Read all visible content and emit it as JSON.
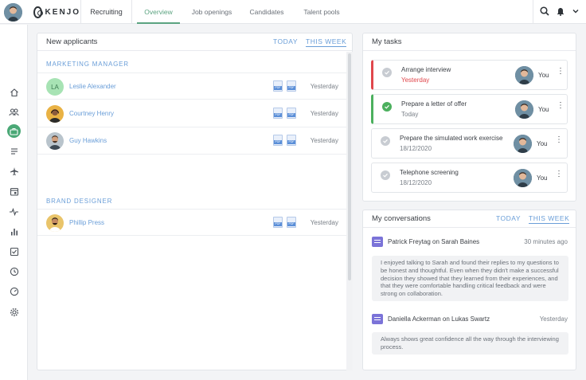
{
  "header": {
    "brand": "KENJO",
    "section": "Recruiting",
    "tabs": [
      {
        "label": "Overview",
        "active": true
      },
      {
        "label": "Job openings",
        "active": false
      },
      {
        "label": "Candidates",
        "active": false
      },
      {
        "label": "Talent pools",
        "active": false
      }
    ]
  },
  "sidebar": {
    "items": [
      "home-icon",
      "people-icon",
      "briefcase-icon",
      "list-icon",
      "plane-icon",
      "calendar-icon",
      "pulse-icon",
      "bar-chart-icon",
      "checkbox-icon",
      "clock-icon",
      "gauge-icon",
      "gear-icon"
    ],
    "active": "briefcase-icon"
  },
  "applicants": {
    "title": "New applicants",
    "period_today": "TODAY",
    "period_week": "THIS WEEK",
    "groups": [
      {
        "label": "MARKETING MANAGER",
        "rows": [
          {
            "name": "Leslie Alexander",
            "initials": "LA",
            "time": "Yesterday",
            "pdf1": "PDF",
            "pdf2": "PDF"
          },
          {
            "name": "Courtney Henry",
            "time": "Yesterday",
            "pdf1": "PDF",
            "pdf2": "PDF"
          },
          {
            "name": "Guy Hawkins",
            "time": "Yesterday",
            "pdf1": "PDF",
            "pdf2": "PDF"
          }
        ]
      },
      {
        "label": "BRAND DESIGNER",
        "rows": [
          {
            "name": "Phillip Press",
            "time": "Yesterday",
            "pdf1": "PDF",
            "pdf2": "PDF"
          }
        ]
      }
    ]
  },
  "tasks": {
    "title": "My tasks",
    "items": [
      {
        "title": "Arrange interview",
        "date": "Yesterday",
        "assignee": "You",
        "status": "overdue"
      },
      {
        "title": "Prepare a letter of offer",
        "date": "Today",
        "assignee": "You",
        "status": "done"
      },
      {
        "title": "Prepare the simulated work exercise",
        "date": "18/12/2020",
        "assignee": "You",
        "status": "pending"
      },
      {
        "title": "Telephone screening",
        "date": "18/12/2020",
        "assignee": "You",
        "status": "pending"
      }
    ]
  },
  "conversations": {
    "title": "My conversations",
    "period_today": "TODAY",
    "period_week": "THIS WEEK",
    "items": [
      {
        "title": "Patrick Freytag on Sarah Baines",
        "time": "30 minutes ago",
        "body": "I enjoyed talking to Sarah and found their replies to my questions to be honest and thoughtful. Even when they didn't make a successful decision they showed that they learned from their experiences, and that they were comfortable handling critical feedback and were strong on collaboration."
      },
      {
        "title": "Daniella Ackerman on Lukas Swartz",
        "time": "Yesterday",
        "body": "Always shows great confidence all the way through the interviewing process."
      }
    ]
  },
  "colors": {
    "accent_green": "#4aa876",
    "link_blue": "#6a9ed8",
    "danger": "#e0474c",
    "conversation": "#7b73d8"
  }
}
